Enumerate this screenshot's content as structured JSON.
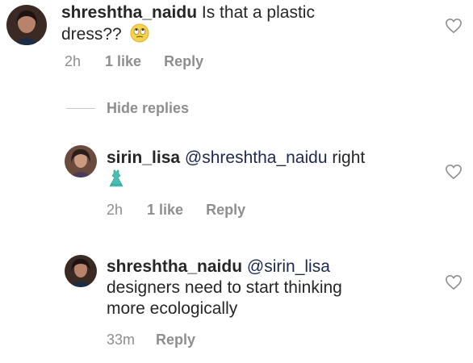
{
  "comments": [
    {
      "username": "shreshtha_naidu",
      "text_line1": "Is that a plastic",
      "text_line2": "dress??",
      "emoji": "eye-roll-emoji",
      "time": "2h",
      "likes": "1 like",
      "reply": "Reply"
    }
  ],
  "hide_replies": "Hide replies",
  "replies": [
    {
      "username": "sirin_lisa",
      "mention": "@shreshtha_naidu",
      "text": "right",
      "emoji": "dress-emoji",
      "time": "2h",
      "likes": "1 like",
      "reply": "Reply"
    },
    {
      "username": "shreshtha_naidu",
      "mention": "@sirin_lisa",
      "text_line2": "designers need to start thinking",
      "text_line3": "more ecologically",
      "time": "33m",
      "reply": "Reply"
    }
  ],
  "icons": {
    "like": "heart-outline-icon"
  },
  "colors": {
    "meta_gray": "#8e8e8e",
    "text": "#262626",
    "mention": "#1c2a4f"
  }
}
